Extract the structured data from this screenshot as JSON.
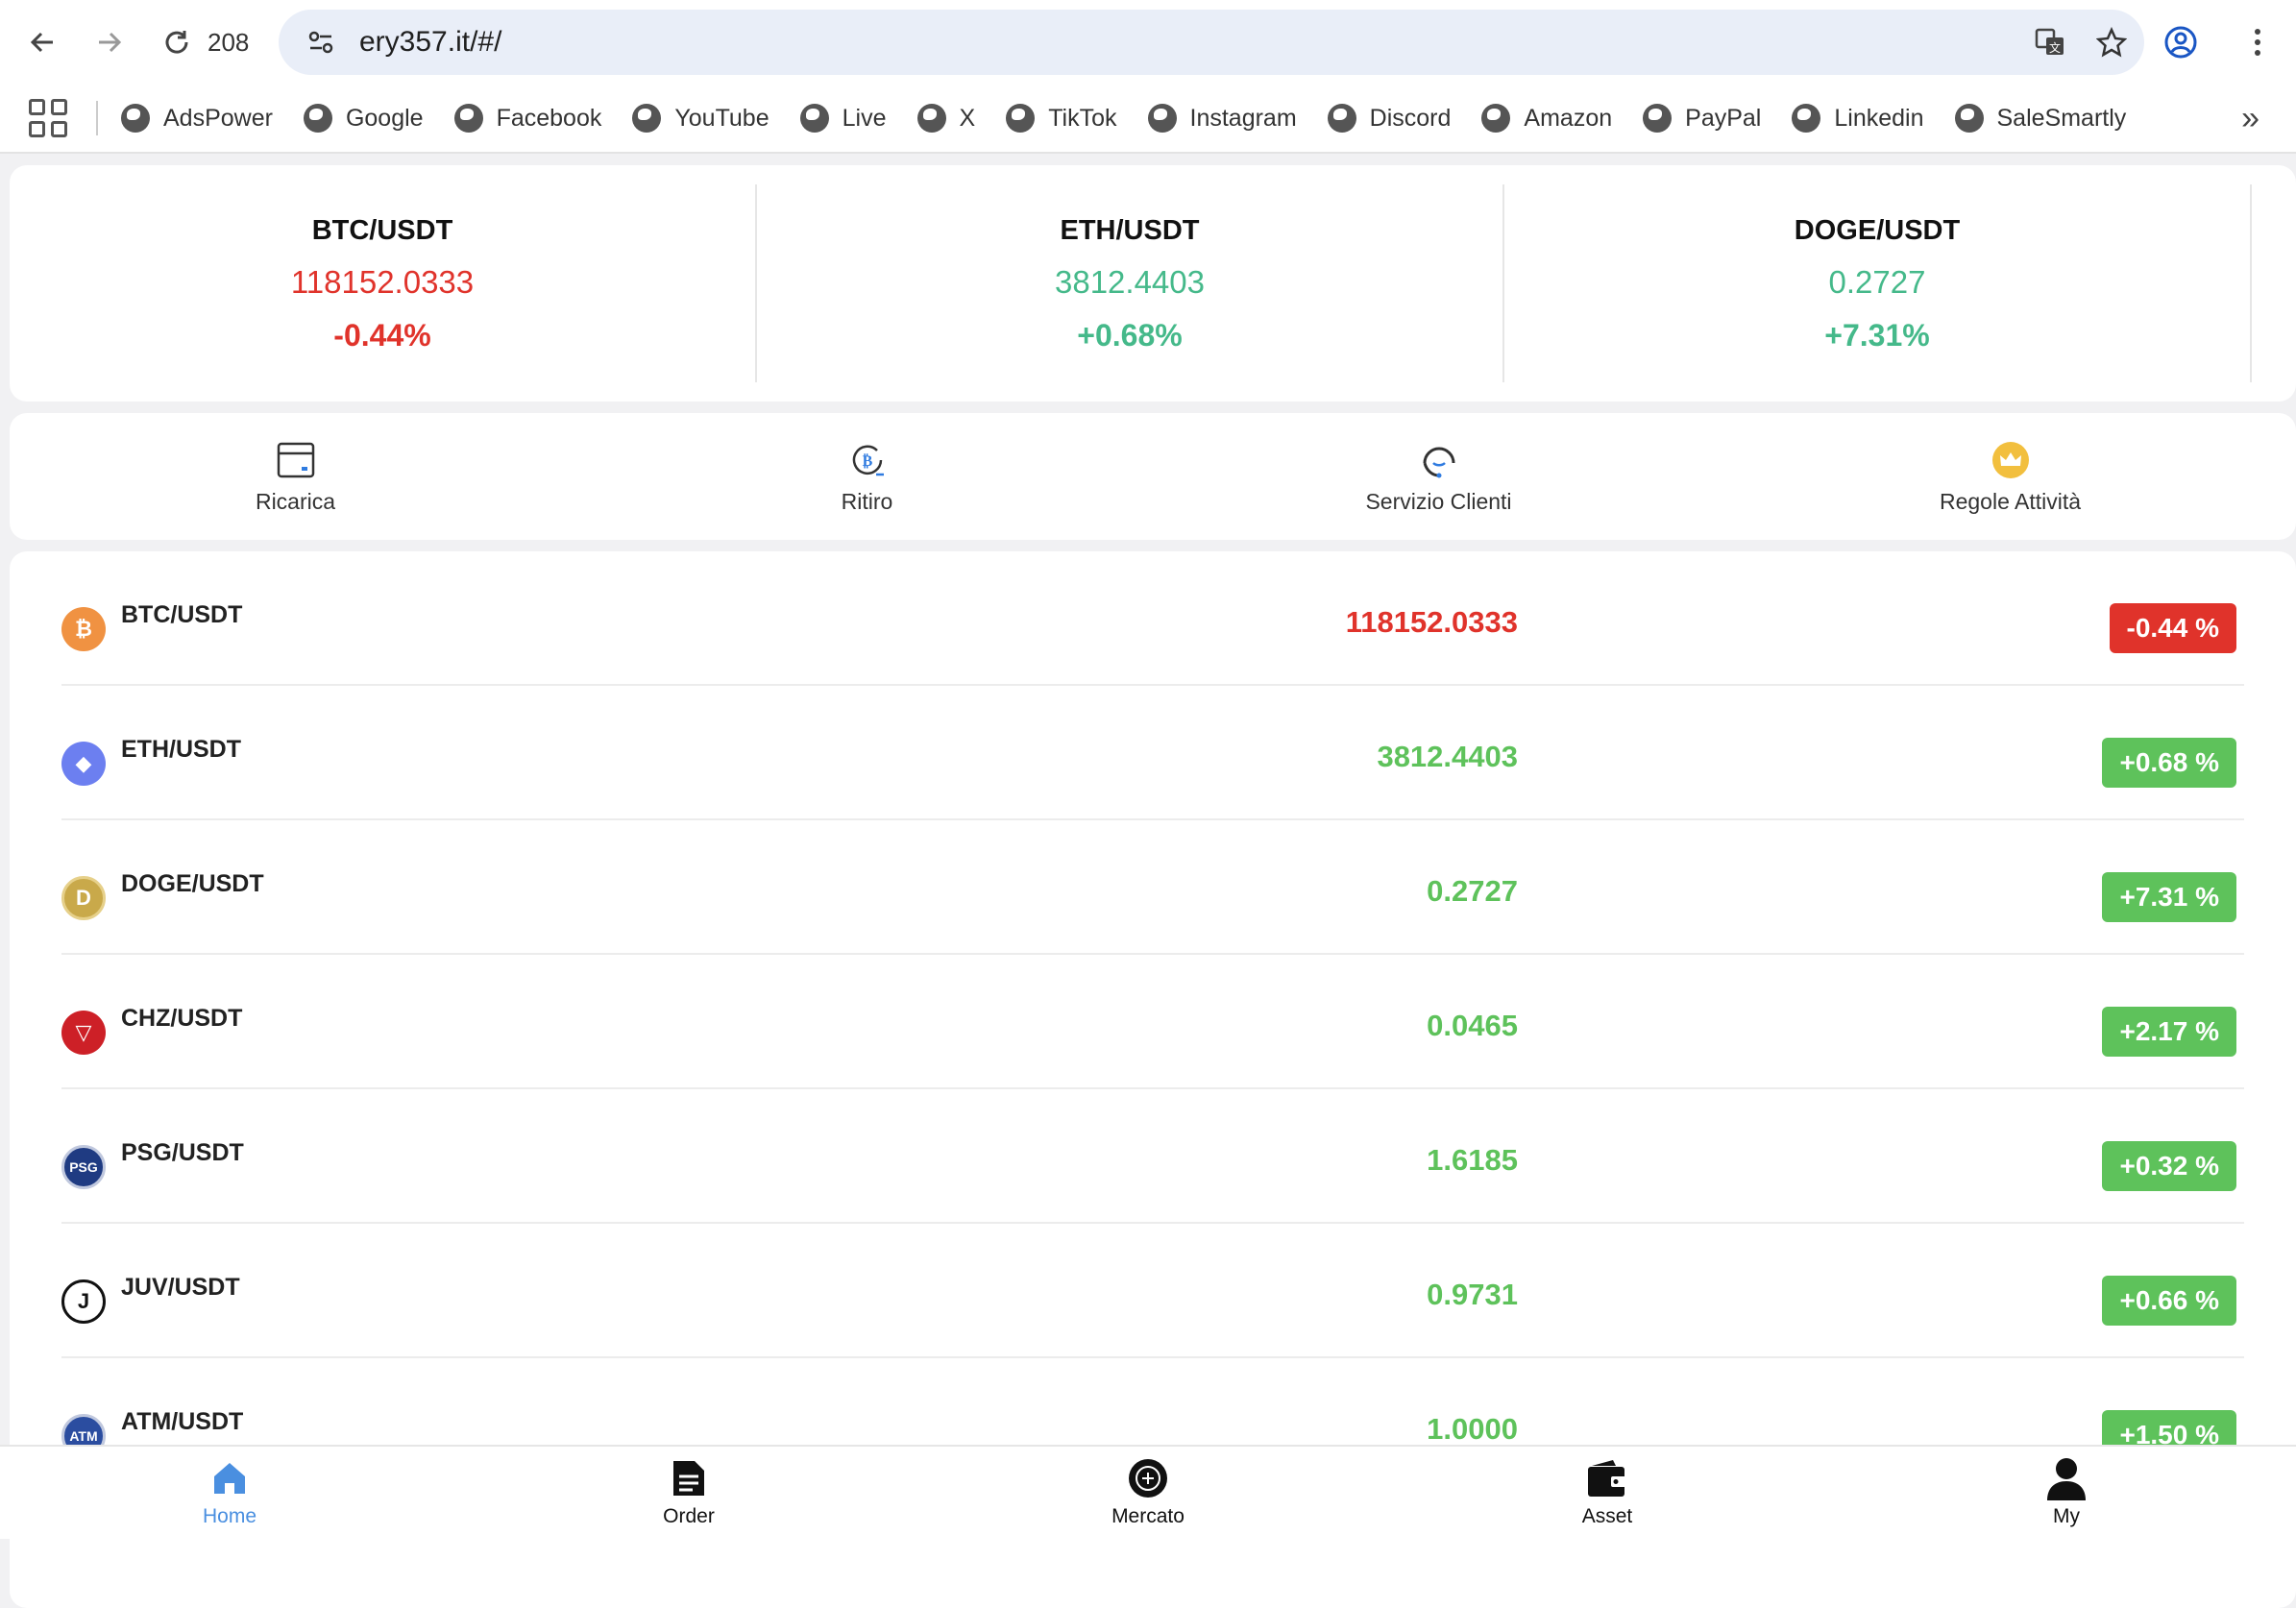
{
  "browser": {
    "tab_count": "208",
    "url": "ery357.it/#/",
    "bookmarks": [
      "AdsPower",
      "Google",
      "Facebook",
      "YouTube",
      "Live",
      "X",
      "TikTok",
      "Instagram",
      "Discord",
      "Amazon",
      "PayPal",
      "Linkedin",
      "SaleSmartly"
    ],
    "more": "»"
  },
  "tickers": [
    {
      "pair": "BTC/USDT",
      "price": "118152.0333",
      "change": "-0.44%",
      "trend": "down"
    },
    {
      "pair": "ETH/USDT",
      "price": "3812.4403",
      "change": "+0.68%",
      "trend": "up"
    },
    {
      "pair": "DOGE/USDT",
      "price": "0.2727",
      "change": "+7.31%",
      "trend": "up"
    }
  ],
  "actions": [
    {
      "label": "Ricarica",
      "icon": "wallet-card-icon"
    },
    {
      "label": "Ritiro",
      "icon": "bitcoin-refresh-icon"
    },
    {
      "label": "Servizio Clienti",
      "icon": "headset-icon"
    },
    {
      "label": "Regole Attività",
      "icon": "crown-icon"
    }
  ],
  "market": [
    {
      "pair": "BTC/USDT",
      "price": "118152.0333",
      "change": "-0.44 %",
      "trend": "down",
      "icon": "bitcoin-icon",
      "color": "#f09242"
    },
    {
      "pair": "ETH/USDT",
      "price": "3812.4403",
      "change": "+0.68 %",
      "trend": "up",
      "icon": "ethereum-icon",
      "color": "#6c7ff0"
    },
    {
      "pair": "DOGE/USDT",
      "price": "0.2727",
      "change": "+7.31 %",
      "trend": "up",
      "icon": "doge-icon",
      "color": "#c9a94a"
    },
    {
      "pair": "CHZ/USDT",
      "price": "0.0465",
      "change": "+2.17 %",
      "trend": "up",
      "icon": "chiliz-icon",
      "color": "#cd2027"
    },
    {
      "pair": "PSG/USDT",
      "price": "1.6185",
      "change": "+0.32 %",
      "trend": "up",
      "icon": "psg-icon",
      "color": "#1f3b82"
    },
    {
      "pair": "JUV/USDT",
      "price": "0.9731",
      "change": "+0.66 %",
      "trend": "up",
      "icon": "juventus-icon",
      "color": "#111111"
    },
    {
      "pair": "ATM/USDT",
      "price": "1.0000",
      "change": "+1.50 %",
      "trend": "up",
      "icon": "atletico-icon",
      "color": "#2b4da0"
    }
  ],
  "bottom_nav": [
    {
      "label": "Home",
      "icon": "home-icon",
      "active": true
    },
    {
      "label": "Order",
      "icon": "document-icon",
      "active": false
    },
    {
      "label": "Mercato",
      "icon": "market-icon",
      "active": false
    },
    {
      "label": "Asset",
      "icon": "wallet-icon",
      "active": false
    },
    {
      "label": "My",
      "icon": "user-icon",
      "active": false
    }
  ],
  "colors": {
    "down": "#e0332b",
    "up_ticker": "#45b98a",
    "up_list": "#5ec25b",
    "nav_active": "#4a8fe0"
  }
}
